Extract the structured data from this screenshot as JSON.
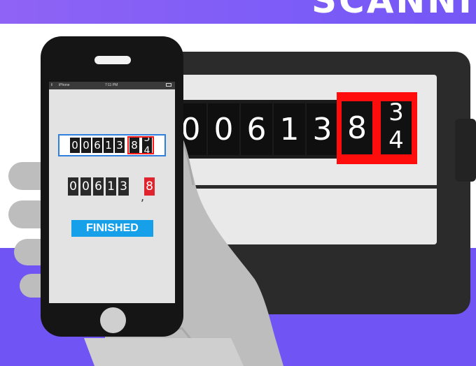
{
  "banner": {
    "title": "SCANNI"
  },
  "meter": {
    "digits": [
      "0",
      "0",
      "6",
      "1",
      "3",
      "8"
    ],
    "rolling_digit": {
      "top": "3",
      "bottom": "4"
    }
  },
  "phone": {
    "status": {
      "carrier": "iPhone",
      "time": "7:11 PM",
      "signal": "ıll"
    },
    "scan_preview": {
      "digits": [
        "0",
        "0",
        "6",
        "1",
        "3",
        "8"
      ],
      "rolling_digit": {
        "top": "3",
        "bottom": "4"
      }
    },
    "result": {
      "digits": [
        "0",
        "0",
        "6",
        "1",
        "3"
      ],
      "decimal_digit": "8",
      "separator": ","
    },
    "status_badge": "FINISHED"
  },
  "colors": {
    "brand_purple": "#7155f4",
    "highlight_red": "#ff0d0d",
    "finished_blue": "#16a0ea"
  }
}
